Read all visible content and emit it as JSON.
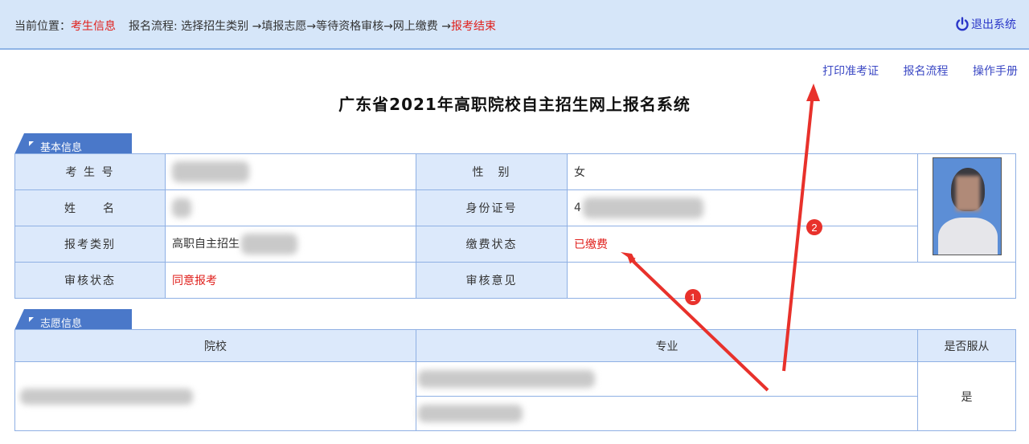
{
  "header": {
    "location_label": "当前位置：",
    "location_value": "考生信息",
    "process_label": "报名流程: 选择招生类别 →填报志愿→等待资格审核→网上缴费 →",
    "process_end": "报考结束",
    "logout_label": "退出系统"
  },
  "links": [
    "打印准考证",
    "报名流程",
    "操作手册"
  ],
  "title": "广东省2021年高职院校自主招生网上报名系统",
  "basic_info": {
    "tab": "基本信息",
    "exam_no_label": "考 生 号",
    "gender_label": "性　别",
    "gender_value": "女",
    "name_label": "姓　　名",
    "id_label": "身份证号",
    "id_prefix": "4",
    "category_label": "报考类别",
    "category_value": "高职自主招生",
    "payment_label": "缴费状态",
    "payment_value": "已缴费",
    "review_status_label": "审核状态",
    "review_status_value": "同意报考",
    "review_opinion_label": "审核意见",
    "review_opinion_value": ""
  },
  "wish_info": {
    "tab": "志愿信息",
    "col_school": "院校",
    "col_major": "专业",
    "col_obey": "是否服从",
    "obey_value": "是"
  },
  "annotations": {
    "marker_1": "1",
    "marker_2": "2"
  },
  "colors": {
    "accent_blue": "#4a78c9",
    "header_bg": "#d6e6f9",
    "label_bg": "#dce9fb",
    "alert_red": "#e0201c",
    "link_blue": "#3b48c4"
  }
}
